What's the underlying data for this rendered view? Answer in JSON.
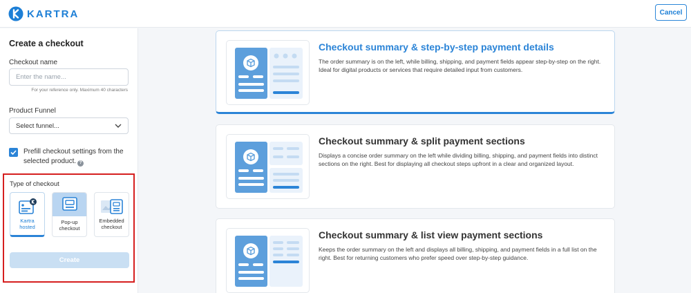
{
  "app": {
    "brand": "KARTRA"
  },
  "header": {
    "cancel_label": "Cancel"
  },
  "sidebar": {
    "title": "Create a checkout",
    "checkout_name": {
      "label": "Checkout name",
      "placeholder": "Enter the name...",
      "value": "",
      "hint": "For your reference only. Maximum 40 characters"
    },
    "product_funnel": {
      "label": "Product Funnel",
      "selected": "Select funnel..."
    },
    "prefill": {
      "checked": true,
      "label": "Prefill checkout settings from the selected product."
    },
    "type_of_checkout": {
      "label": "Type of checkout",
      "options": [
        {
          "line1": "Kartra",
          "line2": "hosted",
          "selected": true
        },
        {
          "line1": "Pop-up",
          "line2": "checkout",
          "selected": false
        },
        {
          "line1": "Embedded",
          "line2": "checkout",
          "selected": false
        }
      ]
    },
    "create_label": "Create"
  },
  "layouts": [
    {
      "title": "Checkout summary & step-by-step payment details",
      "description": "The order summary is on the left, while billing, shipping, and payment fields appear step-by-step on the right. Ideal for digital products or services that require detailed input from customers.",
      "active": true
    },
    {
      "title": "Checkout summary & split payment sections",
      "description": "Displays a concise order summary on the left while dividing billing, shipping, and payment fields into distinct sections on the right. Best for displaying all checkout steps upfront in a clear and organized layout.",
      "active": false
    },
    {
      "title": "Checkout summary & list view payment sections",
      "description": "Keeps the order summary on the left and displays all billing, shipping, and payment fields in a full list on the right. Best for returning customers who prefer speed over step-by-step guidance.",
      "active": false
    }
  ],
  "colors": {
    "brand": "#1d7fd6",
    "accent": "#2b84d7",
    "highlight_border": "#d51e1e",
    "create_disabled": "#c9dff3"
  }
}
